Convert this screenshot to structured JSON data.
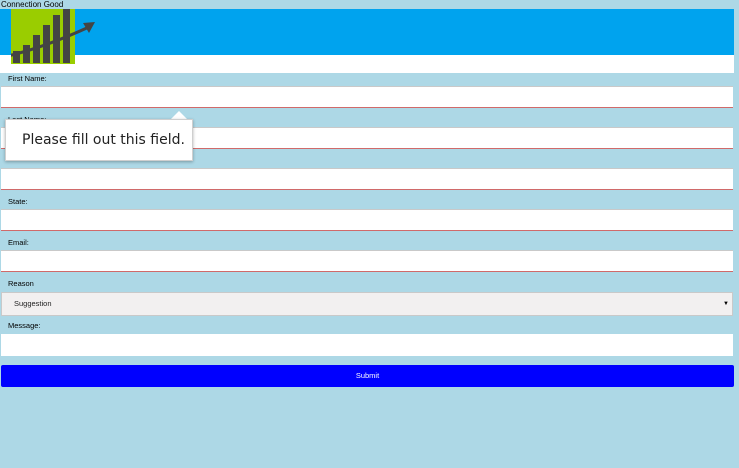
{
  "status": {
    "text": "Connection Good"
  },
  "logo": {
    "icon": "bar-chart-arrow-icon",
    "bg_color": "#9acd00"
  },
  "colors": {
    "background": "#add8e6",
    "banner": "#00a3ee",
    "submit": "#0000ff",
    "invalid_border": "#d06a6a"
  },
  "form": {
    "first_name_label": "First Name:",
    "last_name_label": "Last Name:",
    "state_label": "State:",
    "email_label": "Email:",
    "reason_label": "Reason",
    "reason_selected": "Suggestion",
    "message_label": "Message:",
    "submit_label": "Submit"
  },
  "tooltip": {
    "text": "Please fill out this field."
  }
}
